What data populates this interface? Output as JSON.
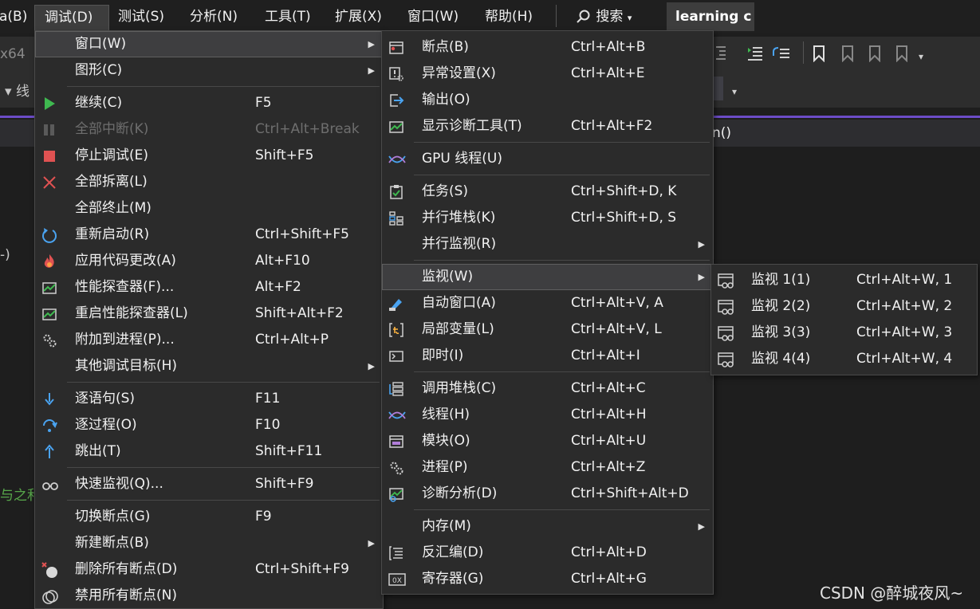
{
  "menubar": {
    "items": [
      "a(B)",
      "调试(D)",
      "测试(S)",
      "分析(N)",
      "工具(T)",
      "扩展(X)",
      "窗口(W)",
      "帮助(H)"
    ],
    "search_label": "搜索",
    "solution_tab": "learning c"
  },
  "background": {
    "platform_fragment": "x64",
    "thread_fragment": "线",
    "func_fragment": "n()",
    "paren_fragment": "-)",
    "comment_fragment": "与之和",
    "watermark": "CSDN @醉城夜风~"
  },
  "debug_menu": {
    "items": [
      {
        "label": "窗口(W)",
        "shortcut": "",
        "submenu": true,
        "highlighted": true,
        "icon": "none"
      },
      {
        "label": "图形(C)",
        "shortcut": "",
        "submenu": true,
        "icon": "none"
      },
      {
        "label": "继续(C)",
        "shortcut": "F5",
        "icon": "play-icon"
      },
      {
        "label": "全部中断(K)",
        "shortcut": "Ctrl+Alt+Break",
        "disabled": true,
        "icon": "pause-icon"
      },
      {
        "label": "停止调试(E)",
        "shortcut": "Shift+F5",
        "icon": "stop-icon"
      },
      {
        "label": "全部拆离(L)",
        "shortcut": "",
        "icon": "detach-icon"
      },
      {
        "label": "全部终止(M)",
        "shortcut": "",
        "icon": "none"
      },
      {
        "label": "重新启动(R)",
        "shortcut": "Ctrl+Shift+F5",
        "icon": "restart-icon"
      },
      {
        "label": "应用代码更改(A)",
        "shortcut": "Alt+F10",
        "icon": "hot-reload-icon"
      },
      {
        "label": "性能探查器(F)...",
        "shortcut": "Alt+F2",
        "icon": "profiler-icon"
      },
      {
        "label": "重启性能探查器(L)",
        "shortcut": "Shift+Alt+F2",
        "icon": "profiler-icon"
      },
      {
        "label": "附加到进程(P)...",
        "shortcut": "Ctrl+Alt+P",
        "icon": "gears-icon"
      },
      {
        "label": "其他调试目标(H)",
        "shortcut": "",
        "submenu": true,
        "icon": "none"
      },
      {
        "label": "逐语句(S)",
        "shortcut": "F11",
        "icon": "step-into-icon"
      },
      {
        "label": "逐过程(O)",
        "shortcut": "F10",
        "icon": "step-over-icon"
      },
      {
        "label": "跳出(T)",
        "shortcut": "Shift+F11",
        "icon": "step-out-icon"
      },
      {
        "label": "快速监视(Q)...",
        "shortcut": "Shift+F9",
        "icon": "glasses-icon"
      },
      {
        "label": "切换断点(G)",
        "shortcut": "F9",
        "icon": "none"
      },
      {
        "label": "新建断点(B)",
        "shortcut": "",
        "submenu": true,
        "icon": "none"
      },
      {
        "label": "删除所有断点(D)",
        "shortcut": "Ctrl+Shift+F9",
        "icon": "delete-breakpoints-icon"
      },
      {
        "label": "禁用所有断点(N)",
        "shortcut": "",
        "icon": "disable-breakpoints-icon"
      }
    ]
  },
  "window_menu": {
    "items": [
      {
        "label": "断点(B)",
        "shortcut": "Ctrl+Alt+B",
        "icon": "breakpoints-window-icon"
      },
      {
        "label": "异常设置(X)",
        "shortcut": "Ctrl+Alt+E",
        "icon": "exception-settings-icon"
      },
      {
        "label": "输出(O)",
        "shortcut": "",
        "icon": "output-icon"
      },
      {
        "label": "显示诊断工具(T)",
        "shortcut": "Ctrl+Alt+F2",
        "icon": "diagnostics-icon"
      },
      {
        "label": "GPU 线程(U)",
        "shortcut": "",
        "icon": "threads-icon"
      },
      {
        "label": "任务(S)",
        "shortcut": "Ctrl+Shift+D, K",
        "icon": "tasks-icon"
      },
      {
        "label": "并行堆栈(K)",
        "shortcut": "Ctrl+Shift+D, S",
        "icon": "parallel-stacks-icon"
      },
      {
        "label": "并行监视(R)",
        "shortcut": "",
        "submenu": true,
        "icon": "none"
      },
      {
        "label": "监视(W)",
        "shortcut": "",
        "submenu": true,
        "highlighted": true,
        "icon": "none"
      },
      {
        "label": "自动窗口(A)",
        "shortcut": "Ctrl+Alt+V, A",
        "icon": "autos-icon"
      },
      {
        "label": "局部变量(L)",
        "shortcut": "Ctrl+Alt+V, L",
        "icon": "locals-icon"
      },
      {
        "label": "即时(I)",
        "shortcut": "Ctrl+Alt+I",
        "icon": "immediate-icon"
      },
      {
        "label": "调用堆栈(C)",
        "shortcut": "Ctrl+Alt+C",
        "icon": "call-stack-icon"
      },
      {
        "label": "线程(H)",
        "shortcut": "Ctrl+Alt+H",
        "icon": "threads-icon"
      },
      {
        "label": "模块(O)",
        "shortcut": "Ctrl+Alt+U",
        "icon": "modules-icon"
      },
      {
        "label": "进程(P)",
        "shortcut": "Ctrl+Alt+Z",
        "icon": "gears-icon"
      },
      {
        "label": "诊断分析(D)",
        "shortcut": "Ctrl+Shift+Alt+D",
        "icon": "diagnostic-analysis-icon"
      },
      {
        "label": "内存(M)",
        "shortcut": "",
        "submenu": true,
        "icon": "none"
      },
      {
        "label": "反汇编(D)",
        "shortcut": "Ctrl+Alt+D",
        "icon": "disassembly-icon"
      },
      {
        "label": "寄存器(G)",
        "shortcut": "Ctrl+Alt+G",
        "icon": "registers-icon"
      }
    ]
  },
  "watch_menu": {
    "items": [
      {
        "label": "监视 1(1)",
        "shortcut": "Ctrl+Alt+W, 1",
        "icon": "watch-window-icon"
      },
      {
        "label": "监视 2(2)",
        "shortcut": "Ctrl+Alt+W, 2",
        "icon": "watch-window-icon"
      },
      {
        "label": "监视 3(3)",
        "shortcut": "Ctrl+Alt+W, 3",
        "icon": "watch-window-icon"
      },
      {
        "label": "监视 4(4)",
        "shortcut": "Ctrl+Alt+W, 4",
        "icon": "watch-window-icon"
      }
    ]
  },
  "colors": {
    "menu_bg": "#2b2b2b",
    "highlight_bg": "#3e3e40",
    "accent_purple": "#6c4cc7",
    "play_green": "#3fb950",
    "stop_red": "#e05252",
    "icon_blue": "#4aa3f0"
  }
}
